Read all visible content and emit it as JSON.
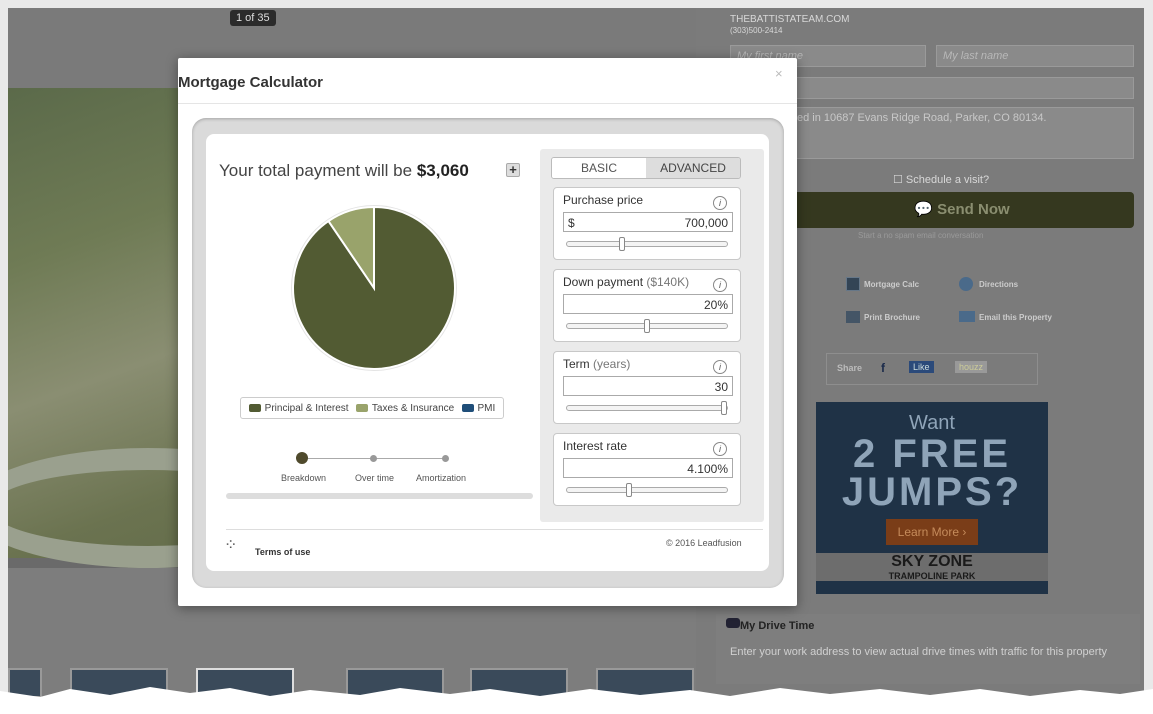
{
  "background": {
    "photo_counter": "1 of 35",
    "site": "THEBATTISTATEAM.COM",
    "phone": "(303)500-2414",
    "first_name_placeholder": "My first name",
    "last_name_placeholder": "My last name",
    "message_partial": "ed in 10687 Evans Ridge Road, Parker, CO 80134.",
    "schedule_visit": "Schedule a visit?",
    "send_now": "Send Now",
    "send_note": "Start a no spam email conversation",
    "links": {
      "mortgage_calc": "Mortgage Calc",
      "directions": "Directions",
      "print_brochure": "Print Brochure",
      "email_property": "Email this Property"
    },
    "share": "Share",
    "like": "Like",
    "houzz": "houzz",
    "ad": {
      "line1": "Want",
      "line2": "2 FREE",
      "line3": "JUMPS?",
      "cta": "Learn More",
      "brand": "SKY ZONE",
      "brand_sub": "TRAMPOLINE PARK"
    },
    "drive_time_title": "My Drive Time",
    "drive_time_text": "Enter your work address to view actual drive times with traffic for this property"
  },
  "modal": {
    "title": "Mortgage Calculator",
    "close": "×",
    "total_prefix": "Your total payment will be",
    "total_value": "$3,060",
    "plus": "+",
    "legend": [
      {
        "label": "Principal & Interest",
        "color": "#525b33"
      },
      {
        "label": "Taxes & Insurance",
        "color": "#99a36b"
      },
      {
        "label": "PMI",
        "color": "#1f4e79"
      }
    ],
    "pie": {
      "principal_interest_fraction": 0.905,
      "taxes_insurance_fraction": 0.095,
      "pmi_fraction": 0
    },
    "steps": [
      {
        "label": "Breakdown"
      },
      {
        "label": "Over time"
      },
      {
        "label": "Amortization"
      }
    ],
    "tabs": {
      "basic": "BASIC",
      "advanced": "ADVANCED"
    },
    "fields": {
      "purchase_price": {
        "label": "Purchase price",
        "prefix": "$",
        "value": "700,000",
        "slider_fraction": 0.34
      },
      "down_payment": {
        "label": "Down payment",
        "sub": "($140K)",
        "value": "20%",
        "slider_fraction": 0.5
      },
      "term": {
        "label": "Term",
        "sub": "(years)",
        "value": "30",
        "slider_fraction": 1.0
      },
      "interest_rate": {
        "label": "Interest rate",
        "value": "4.100%",
        "slider_fraction": 0.38
      }
    },
    "info": "i",
    "terms": "Terms of use",
    "copyright": "© 2016 Leadfusion"
  }
}
